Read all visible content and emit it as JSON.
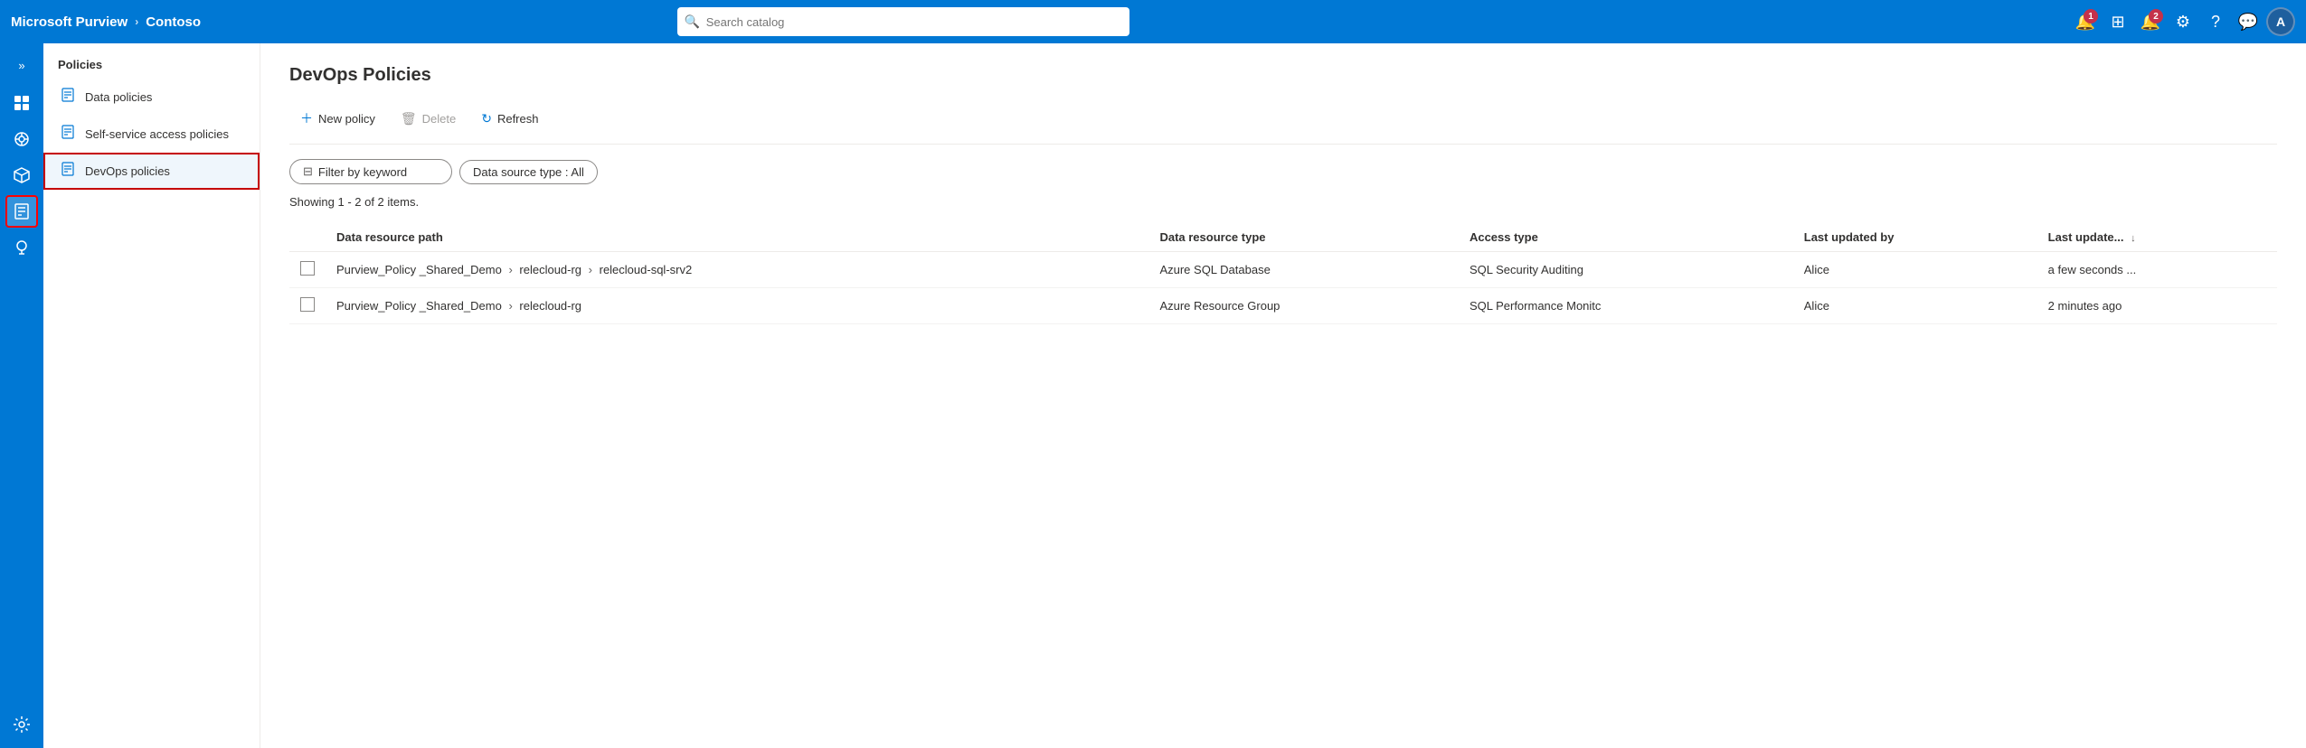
{
  "app": {
    "name": "Microsoft Purview",
    "tenant": "Contoso",
    "chevron": "›"
  },
  "search": {
    "placeholder": "Search catalog"
  },
  "topbar": {
    "notifications_count": "1",
    "alerts_count": "2",
    "avatar_label": "A"
  },
  "rail": {
    "toggle_icon": "»",
    "icons": [
      {
        "id": "home",
        "symbol": "⊞"
      },
      {
        "id": "data-catalog",
        "symbol": "◈"
      },
      {
        "id": "data-map",
        "symbol": "⬡"
      },
      {
        "id": "policies",
        "symbol": "⊟",
        "active": true
      },
      {
        "id": "insights",
        "symbol": "💡"
      },
      {
        "id": "management",
        "symbol": "☰"
      }
    ]
  },
  "sidebar": {
    "section_label": "Policies",
    "items": [
      {
        "id": "data-policies",
        "label": "Data policies",
        "icon": "📋"
      },
      {
        "id": "self-service",
        "label": "Self-service access policies",
        "icon": "📋"
      },
      {
        "id": "devops-policies",
        "label": "DevOps policies",
        "icon": "📋",
        "active": true
      }
    ]
  },
  "content": {
    "page_title": "DevOps Policies",
    "toolbar": {
      "new_policy_label": "New policy",
      "delete_label": "Delete",
      "refresh_label": "Refresh"
    },
    "filter": {
      "keyword_placeholder": "Filter by keyword",
      "datasource_label": "Data source type : All"
    },
    "showing_text": "Showing 1 - 2 of 2 items.",
    "table": {
      "columns": [
        {
          "id": "checkbox",
          "label": ""
        },
        {
          "id": "path",
          "label": "Data resource path"
        },
        {
          "id": "type",
          "label": "Data resource type"
        },
        {
          "id": "access",
          "label": "Access type"
        },
        {
          "id": "updated_by",
          "label": "Last updated by"
        },
        {
          "id": "updated_at",
          "label": "Last update...",
          "sortable": true
        }
      ],
      "rows": [
        {
          "id": "row1",
          "path": "Purview_Policy _Shared_Demo > relecloud-rg > relecloud-sql-srv2",
          "resource_type": "Azure SQL Database",
          "access_type": "SQL Security Auditing",
          "updated_by": "Alice",
          "updated_at": "a few seconds ..."
        },
        {
          "id": "row2",
          "path": "Purview_Policy _Shared_Demo > relecloud-rg",
          "resource_type": "Azure Resource Group",
          "access_type": "SQL Performance Monitc",
          "updated_by": "Alice",
          "updated_at": "2 minutes ago"
        }
      ]
    }
  }
}
